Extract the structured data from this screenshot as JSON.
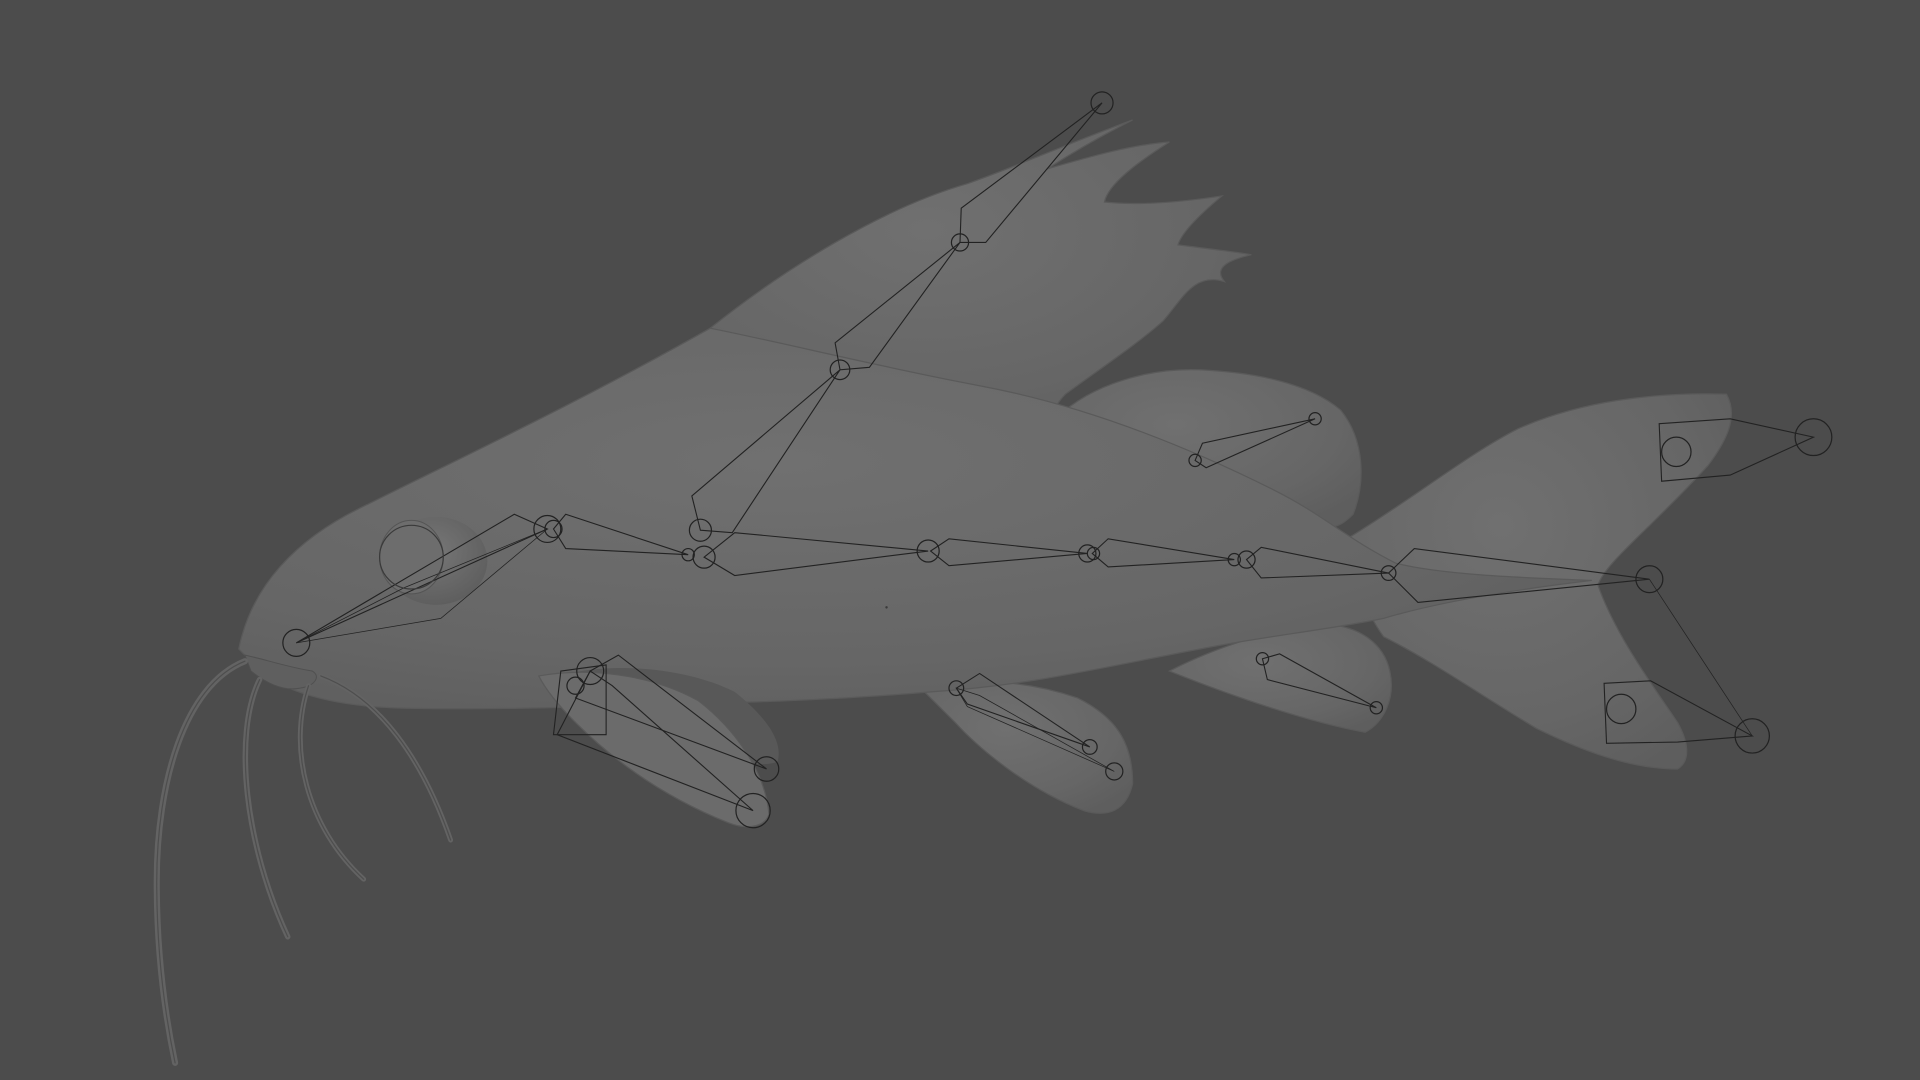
{
  "viewport": {
    "background_color": "#4c4c4c",
    "mesh_color": "#6a6a6a",
    "mesh_shadow_color": "#585858",
    "bone_line_color": "#222222",
    "shown_objects": [
      "catfish-mesh",
      "armature"
    ],
    "icons": [
      "bone-joint-icon",
      "bone-shape-icon",
      "custom-bone-shape-icon"
    ]
  }
}
